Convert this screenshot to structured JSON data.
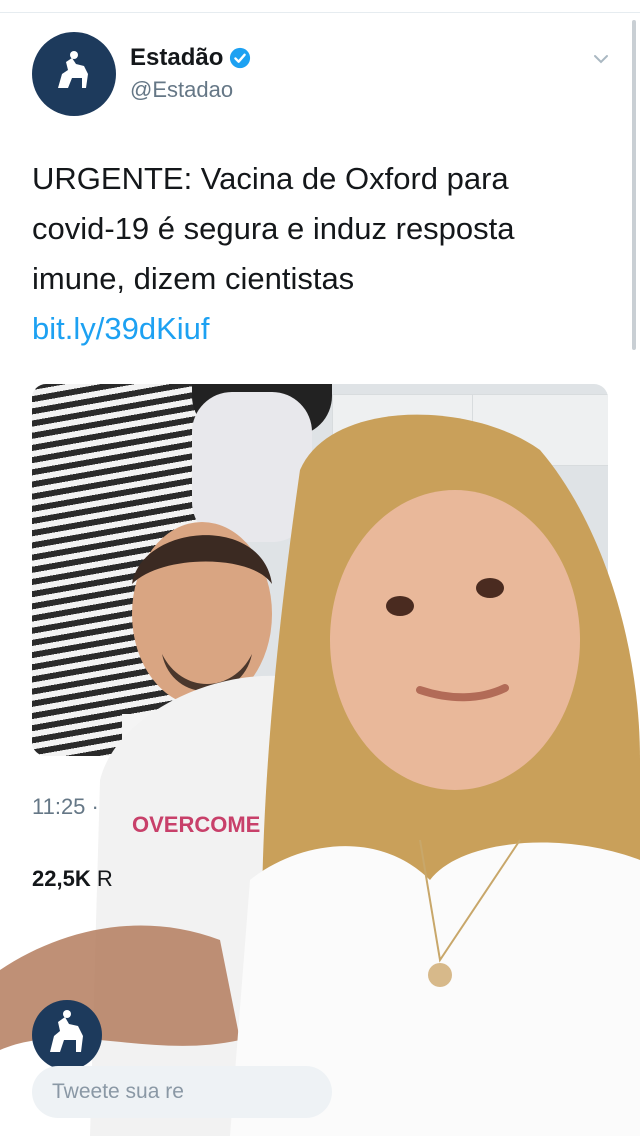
{
  "tweet": {
    "display_name": "Estadão",
    "handle": "@Estadao",
    "verified": true,
    "text": "URGENTE: Vacina de Oxford para covid-19 é segura e induz resposta imune, dizem cientistas",
    "link": "bit.ly/39dKiuf",
    "time": "11:25 ·",
    "retweets_count": "22,5K",
    "retweets_label_partial": "R"
  },
  "reply": {
    "placeholder": "Tweete sua re"
  },
  "overlay": {
    "shirt_text": "OVERCOME"
  },
  "icons": {
    "verified": "verified-badge-icon",
    "caret": "chevron-down-icon",
    "avatar": "estadao-horse-logo"
  },
  "colors": {
    "brand_blue": "#1da1f2",
    "avatar_bg": "#1d3a5c",
    "secondary_text": "#657786"
  }
}
